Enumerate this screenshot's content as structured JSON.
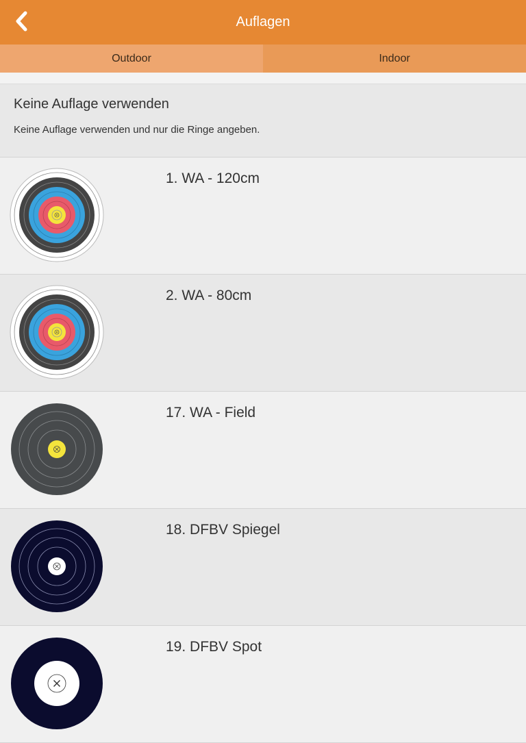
{
  "nav": {
    "title": "Auflagen",
    "back_icon": "chevron-left-icon"
  },
  "tabs": [
    {
      "label": "Outdoor",
      "active": true
    },
    {
      "label": "Indoor",
      "active": false
    }
  ],
  "no_target": {
    "title": "Keine Auflage verwenden",
    "description": "Keine Auflage verwenden und nur die Ringe angeben."
  },
  "targets": [
    {
      "label": "1. WA - 120cm",
      "icon": "wa-target-icon"
    },
    {
      "label": "2. WA - 80cm",
      "icon": "wa-target-icon"
    },
    {
      "label": "17. WA - Field",
      "icon": "field-target-icon"
    },
    {
      "label": "18. DFBV Spiegel",
      "icon": "dfbv-spiegel-target-icon"
    },
    {
      "label": "19. DFBV Spot",
      "icon": "dfbv-spot-target-icon"
    }
  ],
  "colors": {
    "accent": "#e68833",
    "tab_active": "#eea66f",
    "tab_inactive": "#e99a57"
  }
}
